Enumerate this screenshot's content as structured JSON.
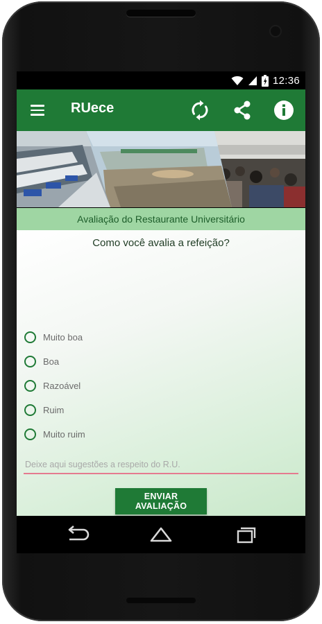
{
  "status_bar": {
    "time": "12:36",
    "icons": [
      "wifi-icon",
      "signal-icon",
      "battery-icon"
    ]
  },
  "app_bar": {
    "title": "RUece",
    "actions": [
      "refresh-icon",
      "share-icon",
      "info-icon"
    ]
  },
  "banner": {
    "images": [
      "cafeteria-interior-photo",
      "restaurant-building-photo",
      "dining-crowd-photo"
    ]
  },
  "section": {
    "title": "Avaliação do Restaurante Universitário"
  },
  "form": {
    "question": "Como você avalia a refeição?",
    "options": [
      "Muito boa",
      "Boa",
      "Razoável",
      "Ruim",
      "Muito ruim"
    ],
    "selected": null,
    "suggestion": {
      "value": "",
      "placeholder": "Deixe aqui sugestões a respeito do R.U."
    },
    "submit_label": "ENVIAR AVALIAÇÃO"
  },
  "nav_bar": {
    "buttons": [
      "back-icon",
      "home-icon",
      "recents-icon"
    ]
  },
  "colors": {
    "primary": "#1f7a36",
    "section_bar": "#9fd6a3",
    "input_underline": "#e57a8f"
  }
}
